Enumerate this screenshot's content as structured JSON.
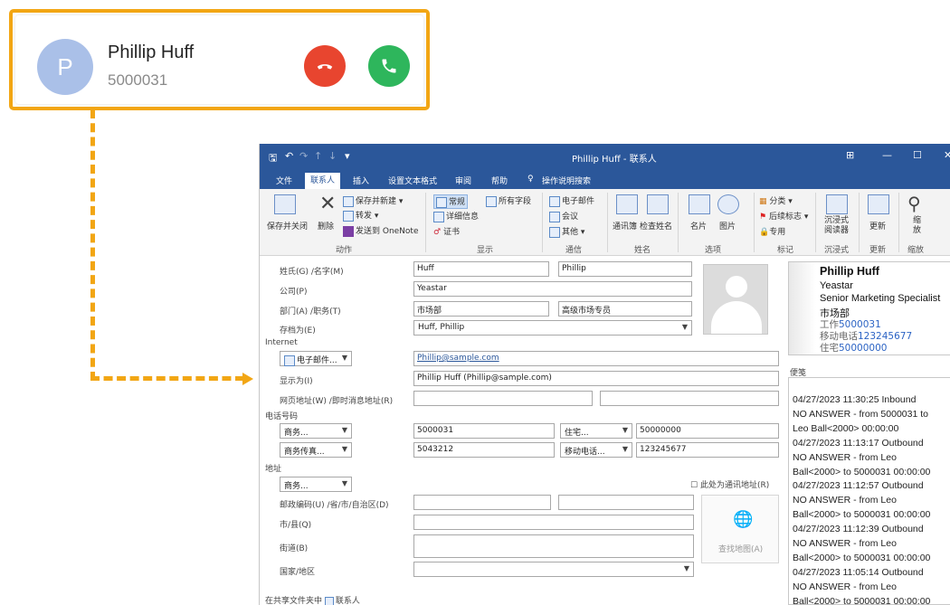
{
  "popup": {
    "avatar_letter": "P",
    "name": "Phillip Huff",
    "number": "5000031",
    "accent": "#f2a614",
    "hangup_color": "#e8452f",
    "answer_color": "#2eb65c"
  },
  "window": {
    "title": "Phillip Huff - 联系人"
  },
  "menu": [
    "文件",
    "联系人",
    "插入",
    "设置文本格式",
    "审阅",
    "帮助",
    "操作说明搜索"
  ],
  "ribbon": {
    "save_close": "保存并关闭",
    "delete": "删除",
    "save_new": "保存并新建",
    "forward": "转发",
    "onenote": "发送到 OneNote",
    "group_action": "动作",
    "general": "常规",
    "details": "详细信息",
    "certificates": "证书",
    "all_fields": "所有字段",
    "group_show": "显示",
    "email": "电子邮件",
    "meeting": "会议",
    "other": "其他",
    "group_communicate": "通信",
    "address_book": "通讯簿",
    "check_names": "检查姓名",
    "group_names": "姓名",
    "business_card": "名片",
    "picture": "图片",
    "group_options": "选项",
    "categorize": "分类",
    "follow_up": "后续标志",
    "private": "专用",
    "group_tags": "标记",
    "immersive": "沉浸式\n阅读器",
    "group_immersive": "沉浸式",
    "update": "更新",
    "group_update": "更新",
    "zoom": "缩\n放",
    "group_zoom": "缩放"
  },
  "form": {
    "name_label": "姓氏(G) /名字(M)",
    "last_name": "Huff",
    "first_name": "Phillip",
    "company_label": "公司(P)",
    "company": "Yeastar",
    "dept_label": "部门(A) /职务(T)",
    "department": "市场部",
    "job_title": "高级市场专员",
    "fileas_label": "存档为(E)",
    "file_as": "Huff, Phillip",
    "internet": "Internet",
    "email_btn": "电子邮件...",
    "email": "Phillip@sample.com",
    "display_label": "显示为(I)",
    "display_as": "Phillip Huff (Phillip@sample.com)",
    "web_label": "网页地址(W) /即时消息地址(R)",
    "phone_section": "电话号码",
    "phone_type1": "商务...",
    "phone1": "5000031",
    "phone_type2": "住宅...",
    "phone2": "50000000",
    "phone_type3": "商务传真...",
    "phone3": "5043212",
    "phone_type4": "移动电话...",
    "phone4": "123245677",
    "address_section": "地址",
    "address_type": "商务...",
    "mailing_label": "此处为通讯地址(R)",
    "postal_label": "邮政编码(U) /省/市/自治区(D)",
    "city_label": "市/县(Q)",
    "street_label": "街道(B)",
    "country_label": "国家/地区",
    "map_label": "查找地图(A)",
    "shared_label": "在共享文件夹中",
    "shared_value": "联系人"
  },
  "card": {
    "name": "Phillip Huff",
    "company": "Yeastar",
    "title": "Senior Marketing Specialist",
    "dept": "市场部",
    "work_label": "工作",
    "work": "5000031",
    "mobile_label": "移动电话",
    "mobile": "123245677",
    "home_label": "住宅",
    "home": "50000000"
  },
  "notes_label": "便笺",
  "notes": [
    "04/27/2023 11:30:25 Inbound",
    "NO ANSWER - from 5000031 to",
    "Leo Ball<2000> 00:00:00",
    "04/27/2023 11:13:17 Outbound",
    "NO ANSWER - from Leo",
    "Ball<2000> to 5000031 00:00:00",
    "04/27/2023 11:12:57 Outbound",
    "NO ANSWER - from Leo",
    "Ball<2000> to 5000031 00:00:00",
    "04/27/2023 11:12:39 Outbound",
    "NO ANSWER - from Leo",
    "Ball<2000> to 5000031 00:00:00",
    "04/27/2023 11:05:14 Outbound",
    "NO ANSWER - from Leo",
    "Ball<2000> to 5000031 00:00:00"
  ]
}
